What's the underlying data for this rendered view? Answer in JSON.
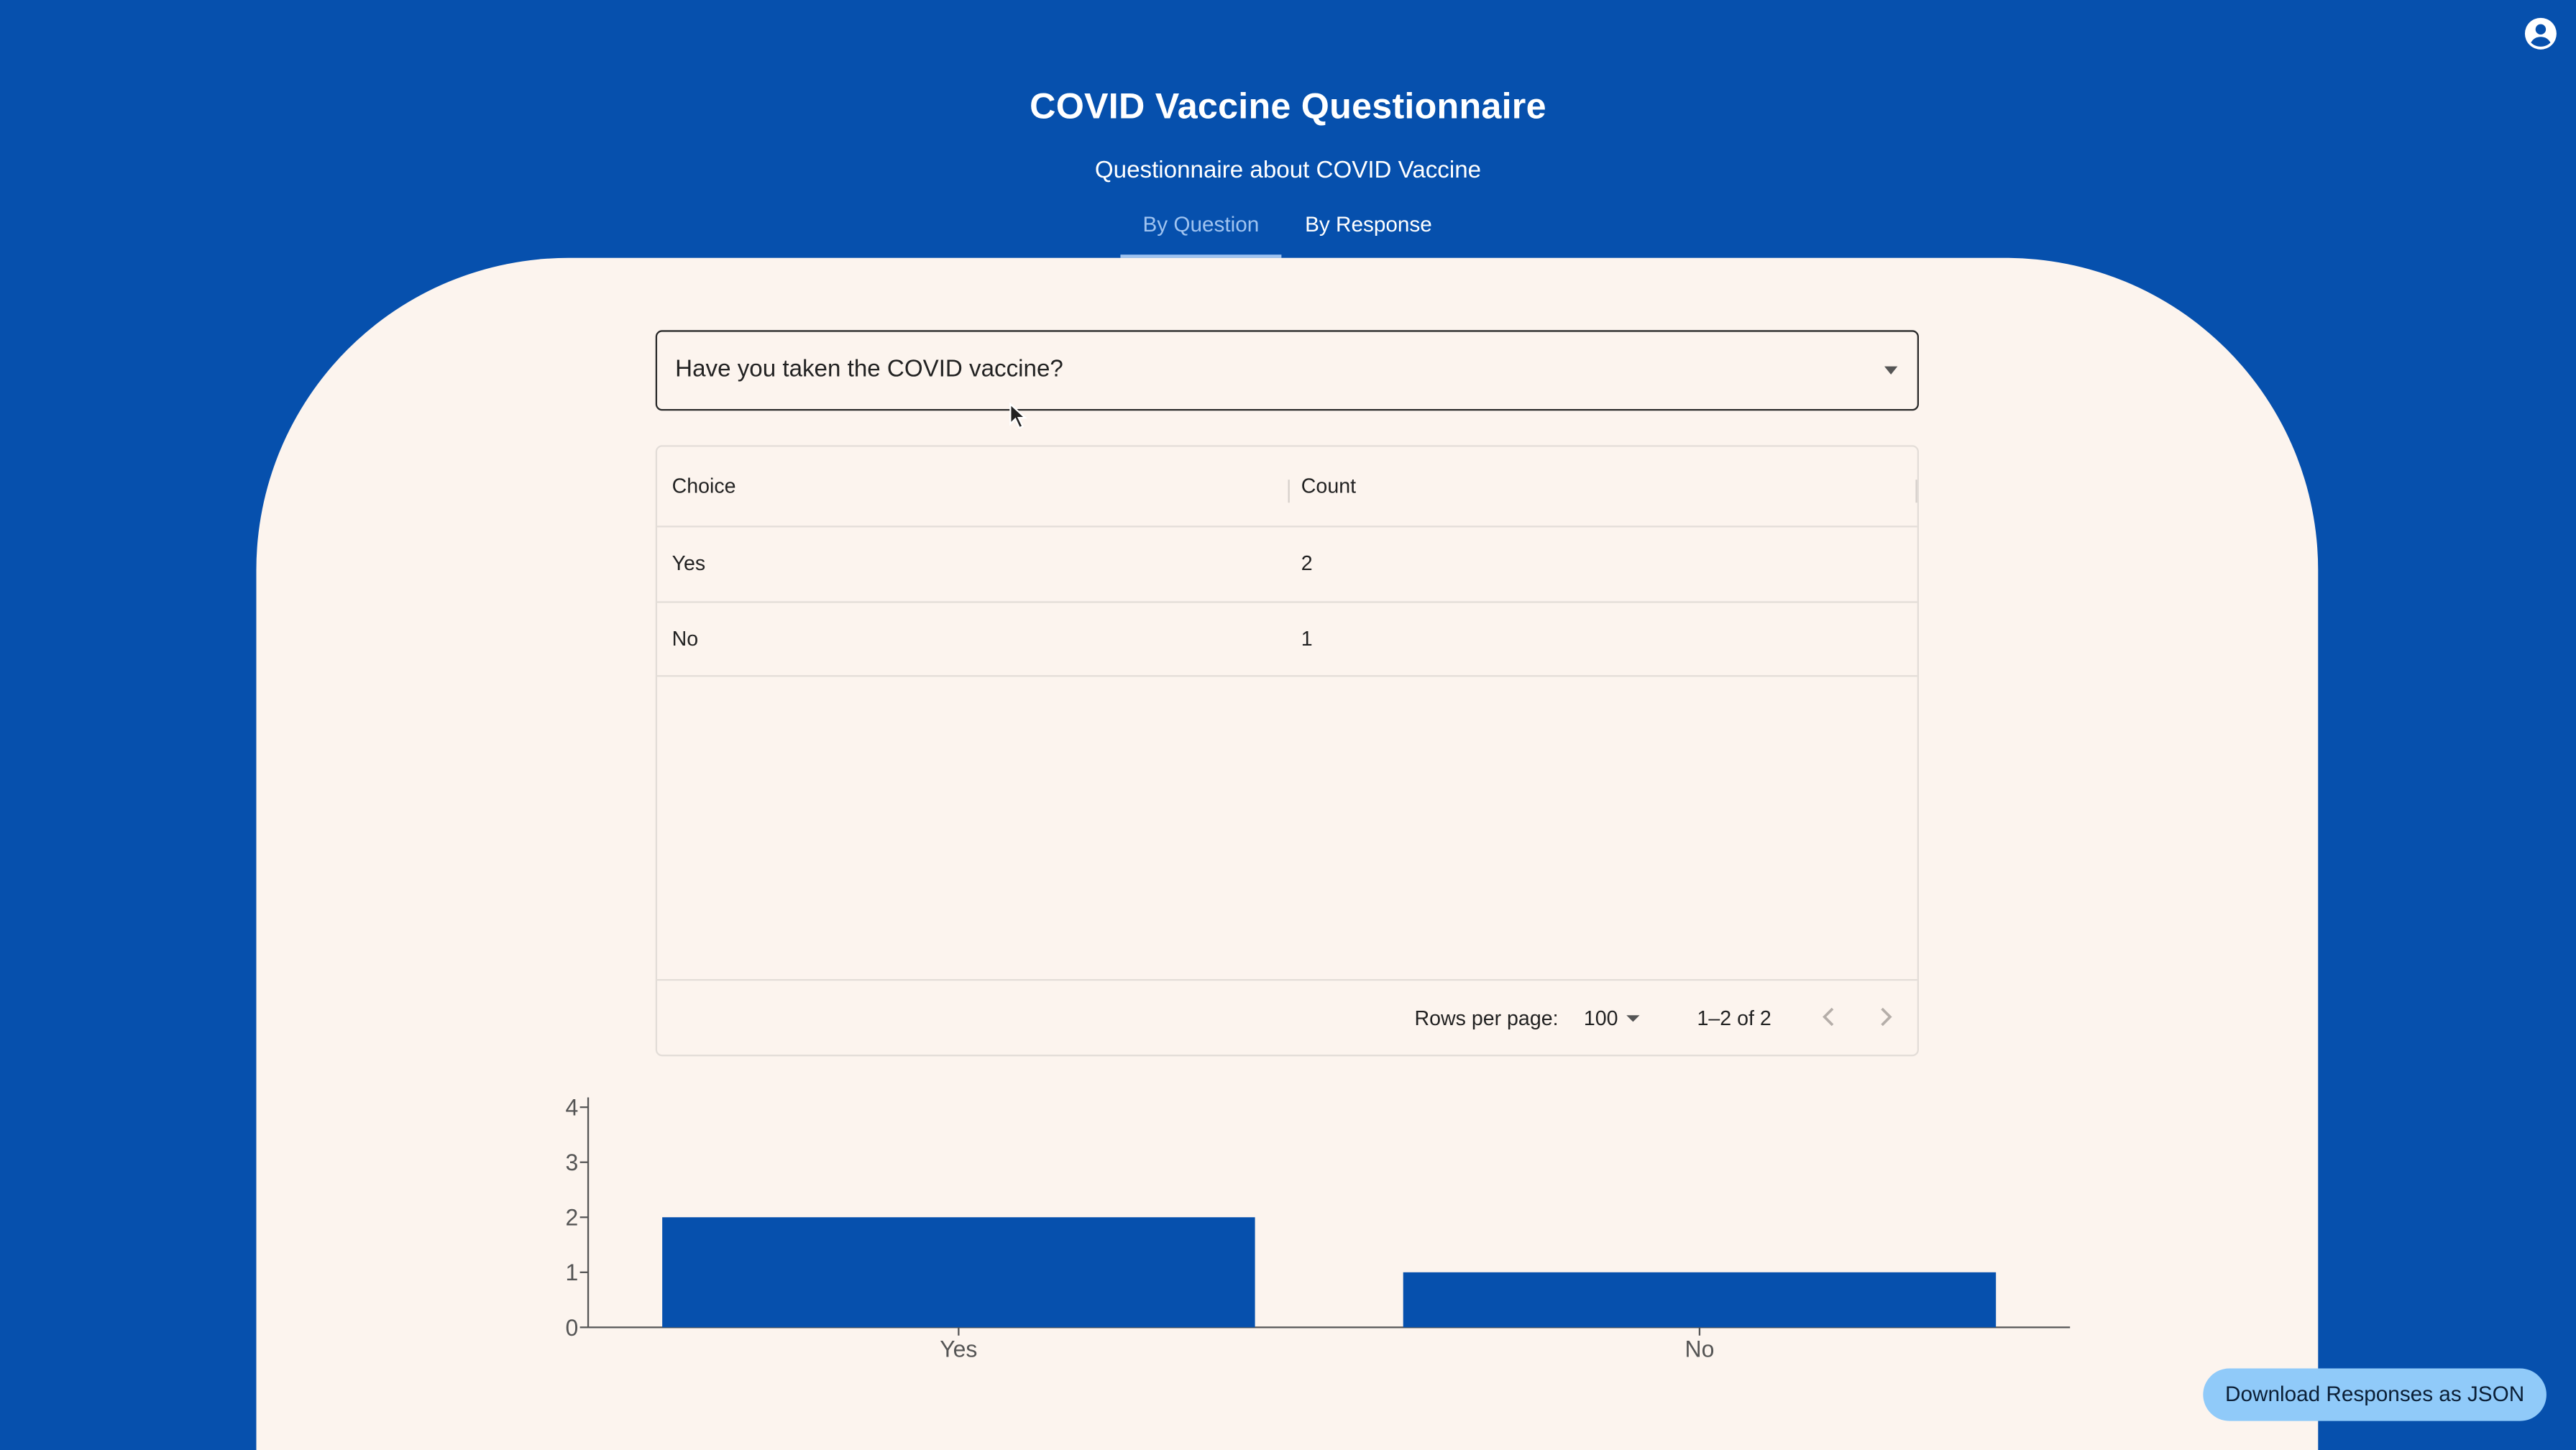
{
  "header": {
    "title": "COVID Vaccine Questionnaire",
    "subtitle": "Questionnaire about COVID Vaccine",
    "tabs": [
      {
        "label": "By Question",
        "active": true
      },
      {
        "label": "By Response",
        "active": false
      }
    ],
    "account_icon": "account-circle-icon"
  },
  "question_select": {
    "value": "Have you taken the COVID vaccine?",
    "icon": "chevron-down-icon"
  },
  "table": {
    "columns": [
      "Choice",
      "Count"
    ],
    "rows": [
      {
        "choice": "Yes",
        "count": "2"
      },
      {
        "choice": "No",
        "count": "1"
      }
    ],
    "footer": {
      "rows_per_page_label": "Rows per page:",
      "rows_per_page_value": "100",
      "range_text": "1–2 of 2"
    }
  },
  "chart_data": {
    "type": "bar",
    "categories": [
      "Yes",
      "No"
    ],
    "values": [
      2,
      1
    ],
    "ylim": [
      0,
      4
    ],
    "yticks": [
      "0",
      "1",
      "2",
      "3",
      "4"
    ],
    "bar_color": "#0650ad",
    "grid": false
  },
  "download_button": {
    "label": "Download Responses as JSON"
  },
  "colors": {
    "background": "#0650ad",
    "panel": "#fcf4ee",
    "accent": "#90caf9",
    "active_tab": "#9fc3f0"
  }
}
